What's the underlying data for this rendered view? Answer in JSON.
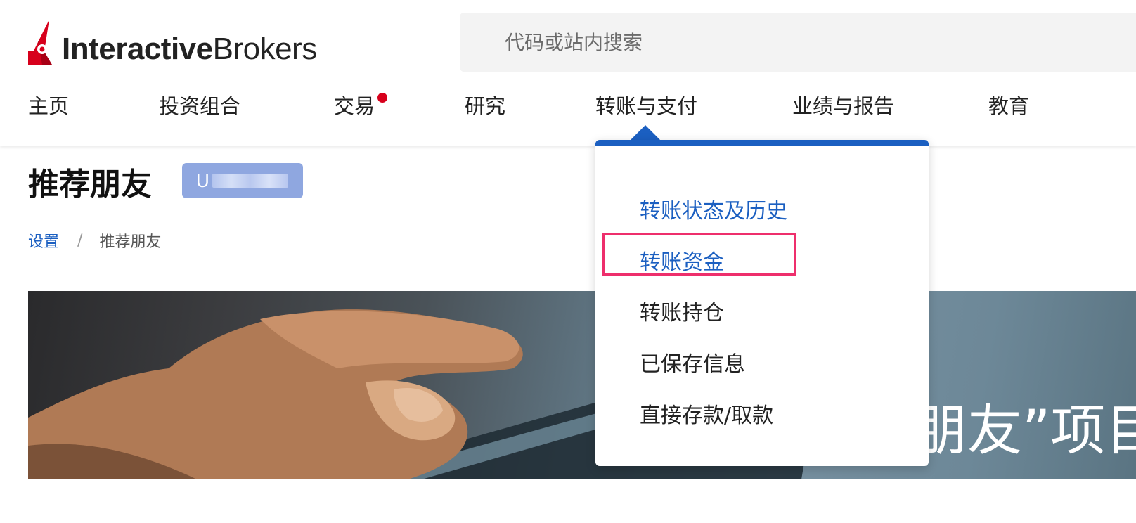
{
  "logo": {
    "bold": "Interactive",
    "light": "Brokers",
    "color": "#d7001c"
  },
  "search": {
    "placeholder": "代码或站内搜索"
  },
  "nav": {
    "items": [
      {
        "label": "主页"
      },
      {
        "label": "投资组合"
      },
      {
        "label": "交易",
        "notification_dot": true
      },
      {
        "label": "研究"
      },
      {
        "label": "转账与支付",
        "expanded": true
      },
      {
        "label": "业绩与报告"
      },
      {
        "label": "教育"
      }
    ]
  },
  "page": {
    "title": "推荐朋友",
    "account_prefix": "U"
  },
  "breadcrumb": {
    "parent": "设置",
    "separator": "/",
    "current": "推荐朋友"
  },
  "banner": {
    "text": "朋友”项目"
  },
  "dropdown": {
    "accent_color": "#1b5fc1",
    "items": [
      {
        "label": "转账状态及历史",
        "active": true
      },
      {
        "label": "转账资金",
        "active": true,
        "highlighted": true
      },
      {
        "label": "转账持仓",
        "active": false
      },
      {
        "label": "已保存信息",
        "active": false
      },
      {
        "label": "直接存款/取款",
        "active": false
      }
    ]
  },
  "colors": {
    "link": "#1b5fc1",
    "highlight": "#ee2f6c",
    "badge": "#8fa7e0"
  }
}
